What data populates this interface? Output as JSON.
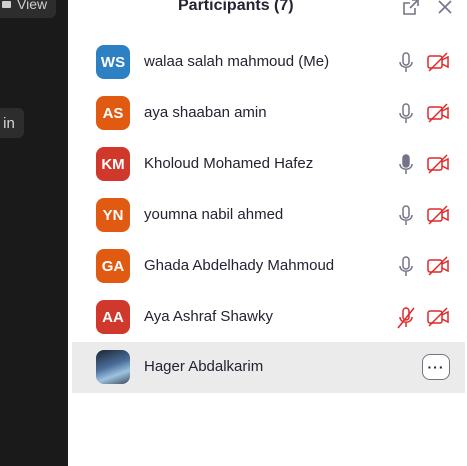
{
  "left_pane": {
    "view_label": "View",
    "side_button_label": "in"
  },
  "panel": {
    "title": "Participants (7)"
  },
  "participants": [
    {
      "initials": "WS",
      "name": "walaa salah mahmoud  (Me)",
      "avatar_color": "#2d81c3",
      "mic": "on",
      "video": "off"
    },
    {
      "initials": "AS",
      "name": "aya shaaban amin",
      "avatar_color": "#e05a12",
      "mic": "on",
      "video": "off"
    },
    {
      "initials": "KM",
      "name": "Kholoud Mohamed Hafez",
      "avatar_color": "#d0382b",
      "mic": "on",
      "video": "off"
    },
    {
      "initials": "YN",
      "name": "youmna nabil ahmed",
      "avatar_color": "#e05a12",
      "mic": "on",
      "video": "off"
    },
    {
      "initials": "GA",
      "name": "Ghada Abdelhady Mahmoud",
      "avatar_color": "#e05a12",
      "mic": "on",
      "video": "off"
    },
    {
      "initials": "AA",
      "name": "Aya Ashraf Shawky",
      "avatar_color": "#d0382b",
      "mic": "muted",
      "video": "off"
    },
    {
      "initials": "",
      "name": "Hager Abdalkarim",
      "avatar_color": "",
      "mic": "",
      "video": "",
      "more_label": "···"
    }
  ],
  "colors": {
    "muted_red": "#e02828",
    "icon_gray": "#747487",
    "title_text": "#232333",
    "highlight_row": "#ebebeb"
  }
}
